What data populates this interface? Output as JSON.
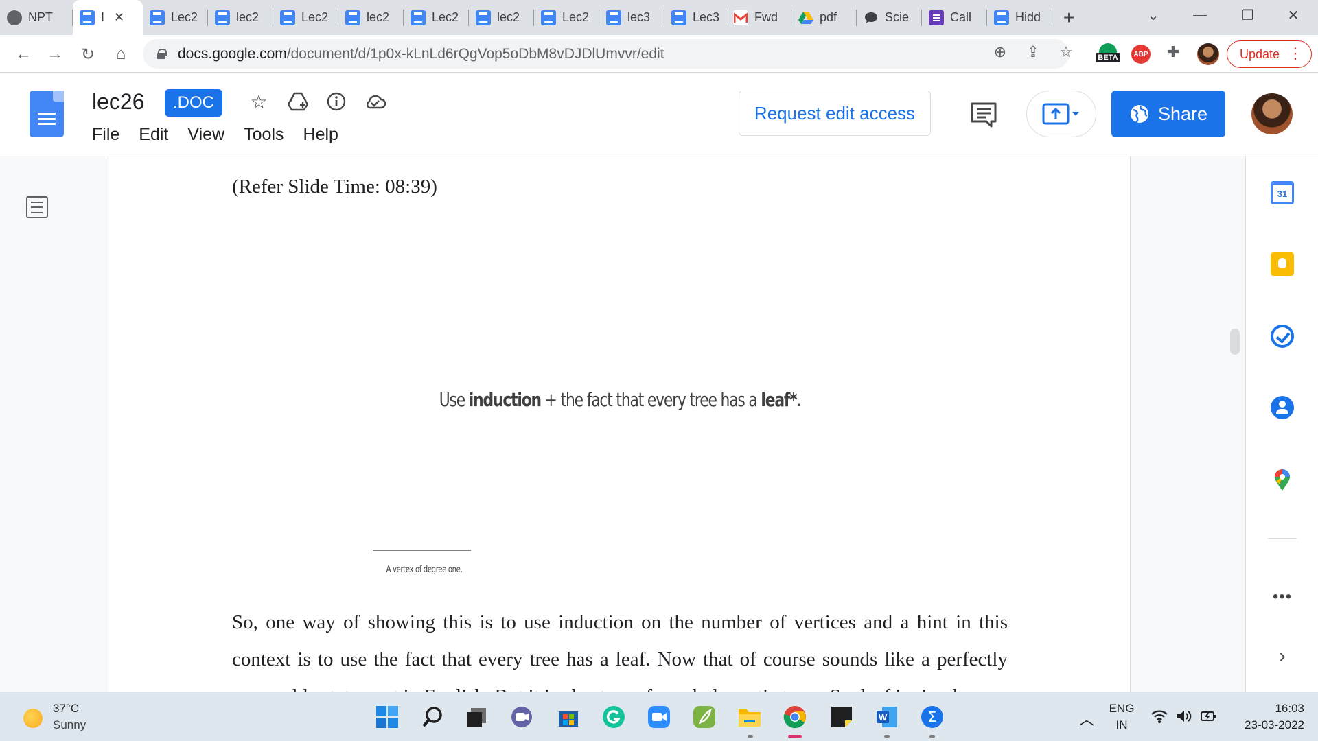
{
  "browser": {
    "tabs": [
      {
        "label": "NPT",
        "icon": "globe-icon",
        "active": false
      },
      {
        "label": "I",
        "icon": "docs-icon",
        "active": true
      },
      {
        "label": "Lec2",
        "icon": "docs-icon"
      },
      {
        "label": "lec2",
        "icon": "docs-icon"
      },
      {
        "label": "Lec2",
        "icon": "docs-icon"
      },
      {
        "label": "lec2",
        "icon": "docs-icon"
      },
      {
        "label": "Lec2",
        "icon": "docs-icon"
      },
      {
        "label": "lec2",
        "icon": "docs-icon"
      },
      {
        "label": "Lec2",
        "icon": "docs-icon"
      },
      {
        "label": "lec3",
        "icon": "docs-icon"
      },
      {
        "label": "Lec3",
        "icon": "docs-icon"
      },
      {
        "label": "Fwd",
        "icon": "gmail-icon"
      },
      {
        "label": "pdf",
        "icon": "drive-icon"
      },
      {
        "label": "Scie",
        "icon": "chat-icon"
      },
      {
        "label": "Call",
        "icon": "forms-icon"
      },
      {
        "label": "Hidd",
        "icon": "docs-icon"
      }
    ],
    "url_host": "docs.google.com",
    "url_path": "/document/d/1p0x-kLnLd6rQgVop5oDbM8vDJDlUmvvr/edit",
    "beta_label": "BETA",
    "abp_label": "ABP",
    "update_label": "Update"
  },
  "docs": {
    "title": "lec26",
    "badge": ".DOC",
    "menu": [
      "File",
      "Edit",
      "View",
      "Tools",
      "Help"
    ],
    "request_edit_label": "Request edit access",
    "share_label": "Share"
  },
  "document": {
    "refer_text": "(Refer Slide Time: 08:39)",
    "slide_text_before": "Use ",
    "slide_text_bold1": "induction",
    "slide_text_middle": " + the fact that every tree has a ",
    "slide_text_bold2": "leaf*",
    "slide_text_after": ".",
    "footnote": "A vertex of degree one.",
    "paragraph": "So, one way of showing this is to use induction on the number of vertices and a hint in this context is to use the fact that every tree has a leaf. Now that of course sounds like a perfectly reasonable statement in English. But it is also true of graph theoretic trees. So, leaf is simply"
  },
  "side_panel": {
    "calendar_day": "31",
    "more_label": "•••",
    "chevron": "›"
  },
  "taskbar": {
    "temperature": "37°C",
    "weather": "Sunny",
    "lang_line1": "ENG",
    "lang_line2": "IN",
    "time": "16:03",
    "date": "23-03-2022"
  }
}
